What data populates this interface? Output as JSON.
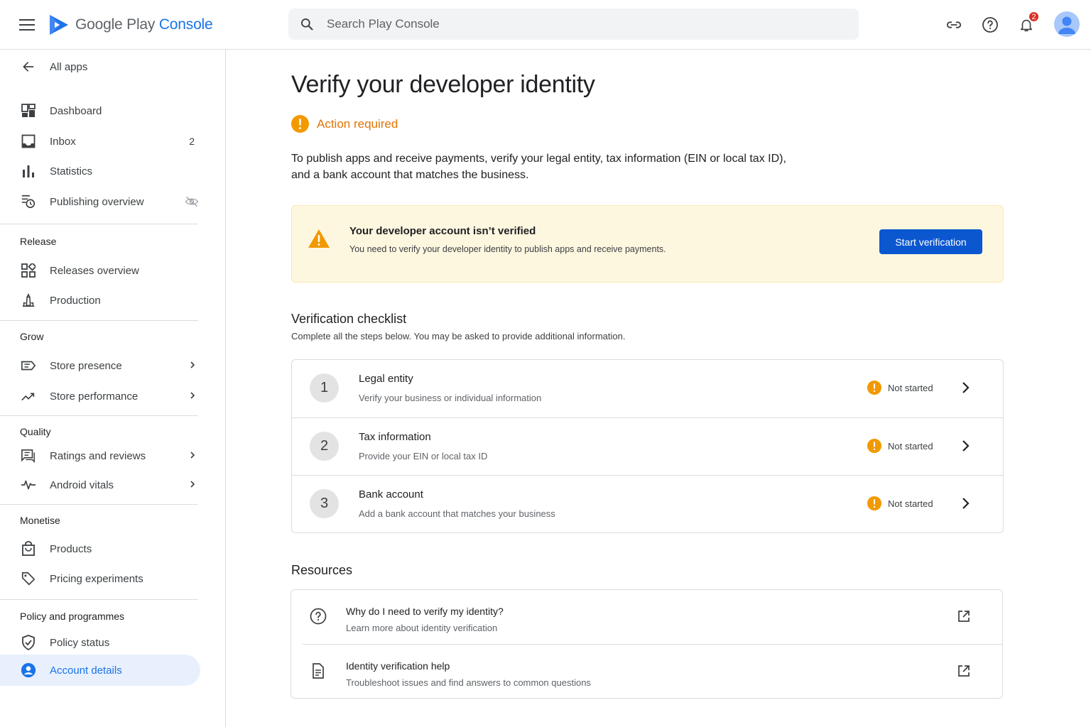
{
  "app": {
    "logo_word": "Google Play",
    "logo_accent": "Console",
    "search_placeholder": "Search Play Console",
    "notification_count": "2"
  },
  "sidebar": {
    "back_label": "All apps",
    "top_items": [
      {
        "label": "Dashboard",
        "icon": "dashboard-icon"
      },
      {
        "label": "Inbox",
        "icon": "inbox-icon",
        "count": "2"
      },
      {
        "label": "Statistics",
        "icon": "bar-chart-icon"
      },
      {
        "label": "Publishing overview",
        "icon": "publishing-icon"
      }
    ],
    "sections": {
      "release": {
        "title": "Release",
        "items": [
          "Releases overview",
          "Production"
        ]
      },
      "grow": {
        "title": "Grow",
        "items": [
          "Store presence",
          "Store performance"
        ]
      },
      "quality": {
        "title": "Quality",
        "items": [
          "Ratings and reviews",
          "Android vitals"
        ]
      },
      "monetise": {
        "title": "Monetise",
        "items": [
          "Products",
          "Pricing experiments"
        ]
      },
      "policy": {
        "title": "Policy and programmes",
        "items": [
          "Policy status",
          "Account details"
        ]
      }
    },
    "active_item": "Account details"
  },
  "main": {
    "title": "Verify your developer identity",
    "status_label": "Action required",
    "intro_line1": "To publish apps and receive payments, verify your legal entity, tax information (EIN or local tax ID),",
    "intro_line2": "and a bank account that matches the business.",
    "warning": {
      "title": "Your developer account isn’t verified",
      "subtitle": "You need to verify your developer identity to publish apps and receive payments.",
      "button": "Start verification"
    },
    "checklist": {
      "title": "Verification checklist",
      "subtitle": "Complete all the steps below. You may be asked to provide additional information.",
      "steps": [
        {
          "num": "1",
          "title": "Legal entity",
          "subtitle": "Verify your business or individual information",
          "status": "Not started"
        },
        {
          "num": "2",
          "title": "Tax information",
          "subtitle": "Provide your EIN or local tax ID",
          "status": "Not started"
        },
        {
          "num": "3",
          "title": "Bank account",
          "subtitle": "Add a bank account that matches your business",
          "status": "Not started"
        }
      ]
    },
    "resources": {
      "title": "Resources",
      "items": [
        {
          "title": "Why do I need to verify my identity?",
          "subtitle": "Learn more about identity verification",
          "icon": "help-circle-icon"
        },
        {
          "title": "Identity verification help",
          "subtitle": "Troubleshoot issues and find answers to common questions",
          "icon": "document-icon"
        }
      ]
    }
  },
  "colors": {
    "accent": "#1a73e8",
    "primary_button": "#0b57d0",
    "warning": "#f29900",
    "warning_text": "#e37400",
    "warning_bg": "#fef7e0",
    "active_nav_bg": "#e8f0fe"
  }
}
